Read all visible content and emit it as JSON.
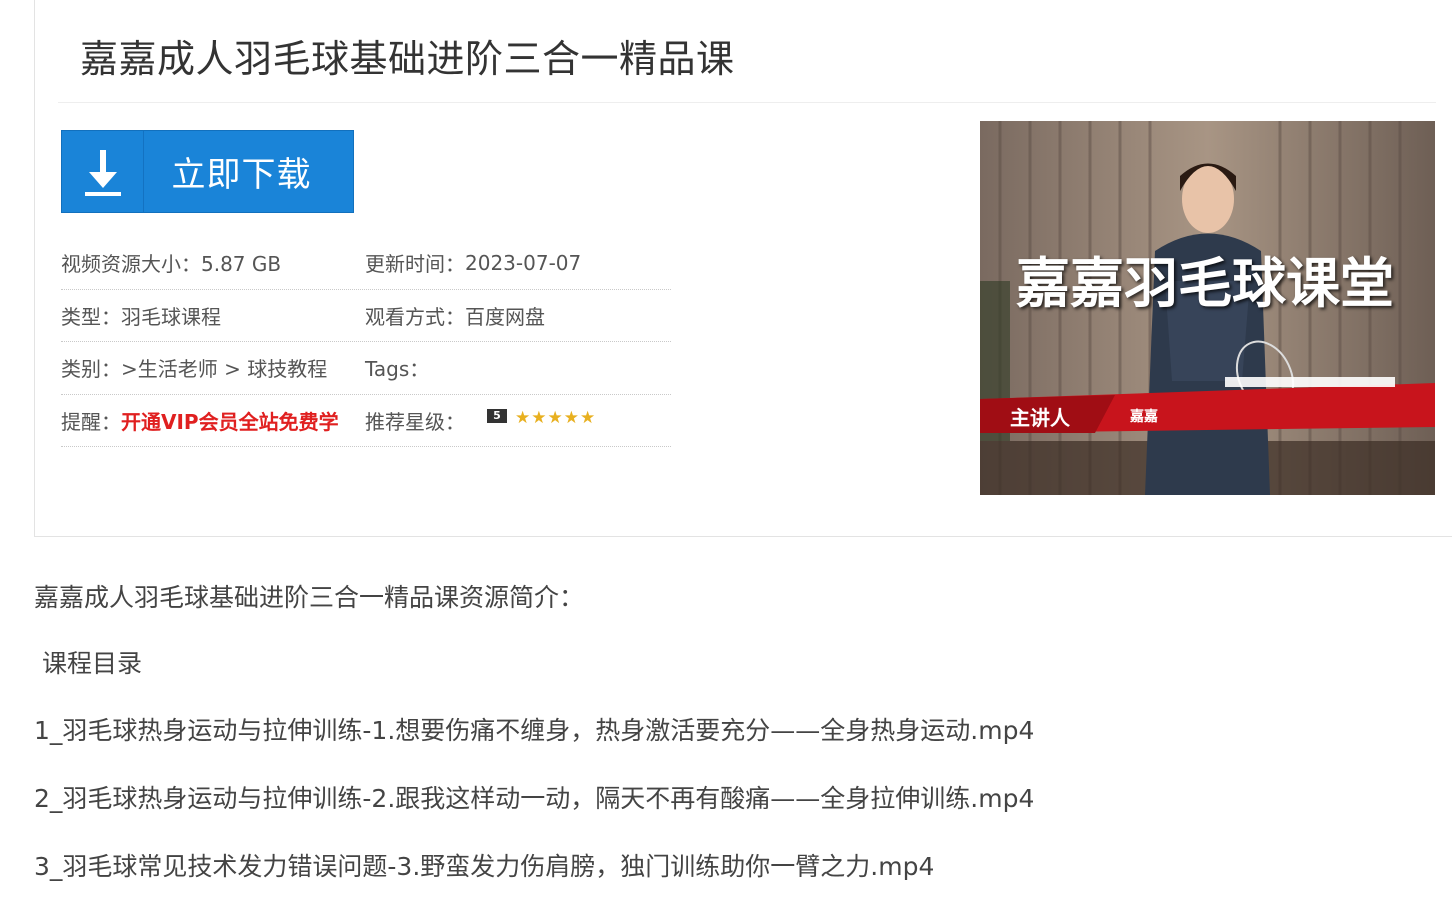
{
  "title": "嘉嘉成人羽毛球基础进阶三合一精品课",
  "download": {
    "label": "立即下载",
    "icon": "download-arrow-icon"
  },
  "info": {
    "size_label": "视频资源大小：",
    "size_value": "5.87 GB",
    "updated_label": "更新时间：",
    "updated_value": "2023-07-07",
    "type_label": "类型：",
    "type_value": "羽毛球课程",
    "watch_label": "观看方式：",
    "watch_value": "百度网盘",
    "category_label": "类别：",
    "category_sep1": ">",
    "category_1": "生活老师",
    "category_sep2": " > ",
    "category_2": "球技教程",
    "tags_label": "Tags：",
    "reminder_label": "提醒：",
    "reminder_value": "开通VIP会员全站免费学",
    "stars_label": "推荐星级：",
    "stars_badge": "5",
    "stars_count": 5,
    "star_color": "#e8b020"
  },
  "thumbnail": {
    "headline": "嘉嘉羽毛球课堂",
    "presenter_label": "主讲人",
    "presenter_name": "嘉嘉"
  },
  "description": {
    "heading": "嘉嘉成人羽毛球基础进阶三合一精品课资源简介：",
    "catalog_title": "课程目录",
    "lessons": [
      "1_羽毛球热身运动与拉伸训练-1.想要伤痛不缠身，热身激活要充分——全身热身运动.mp4",
      "2_羽毛球热身运动与拉伸训练-2.跟我这样动一动，隔天不再有酸痛——全身拉伸训练.mp4",
      "3_羽毛球常见技术发力错误问题-3.野蛮发力伤肩膀，独门训练助你一臂之力.mp4"
    ]
  },
  "colors": {
    "button_blue": "#1a84d8",
    "reminder_red": "#e02020"
  }
}
